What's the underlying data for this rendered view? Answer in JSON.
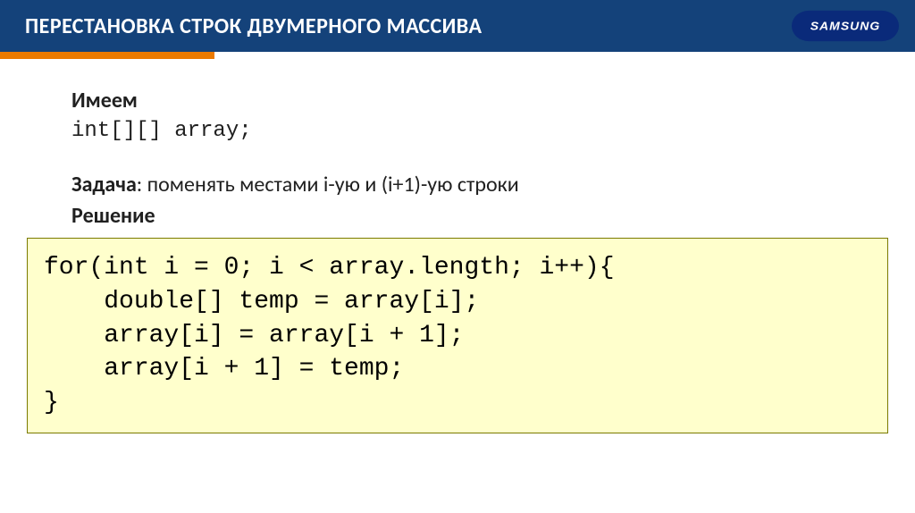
{
  "header": {
    "title": "ПЕРЕСТАНОВКА СТРОК ДВУМЕРНОГО МАССИВА",
    "logo_text": "SAMSUNG"
  },
  "body": {
    "line1_label": "Имеем",
    "line2_decl": "int[][] array;",
    "task_label": "Задача",
    "task_text": ": поменять местами i-ую и (i+1)-ую строки",
    "solution_label": "Решение"
  },
  "code": {
    "l1": "for(int i = 0; i < array.length; i++){",
    "l2": "    double[] temp = array[i];",
    "l3": "    array[i] = array[i + 1];",
    "l4": "    array[i + 1] = temp;",
    "l5": "}"
  }
}
